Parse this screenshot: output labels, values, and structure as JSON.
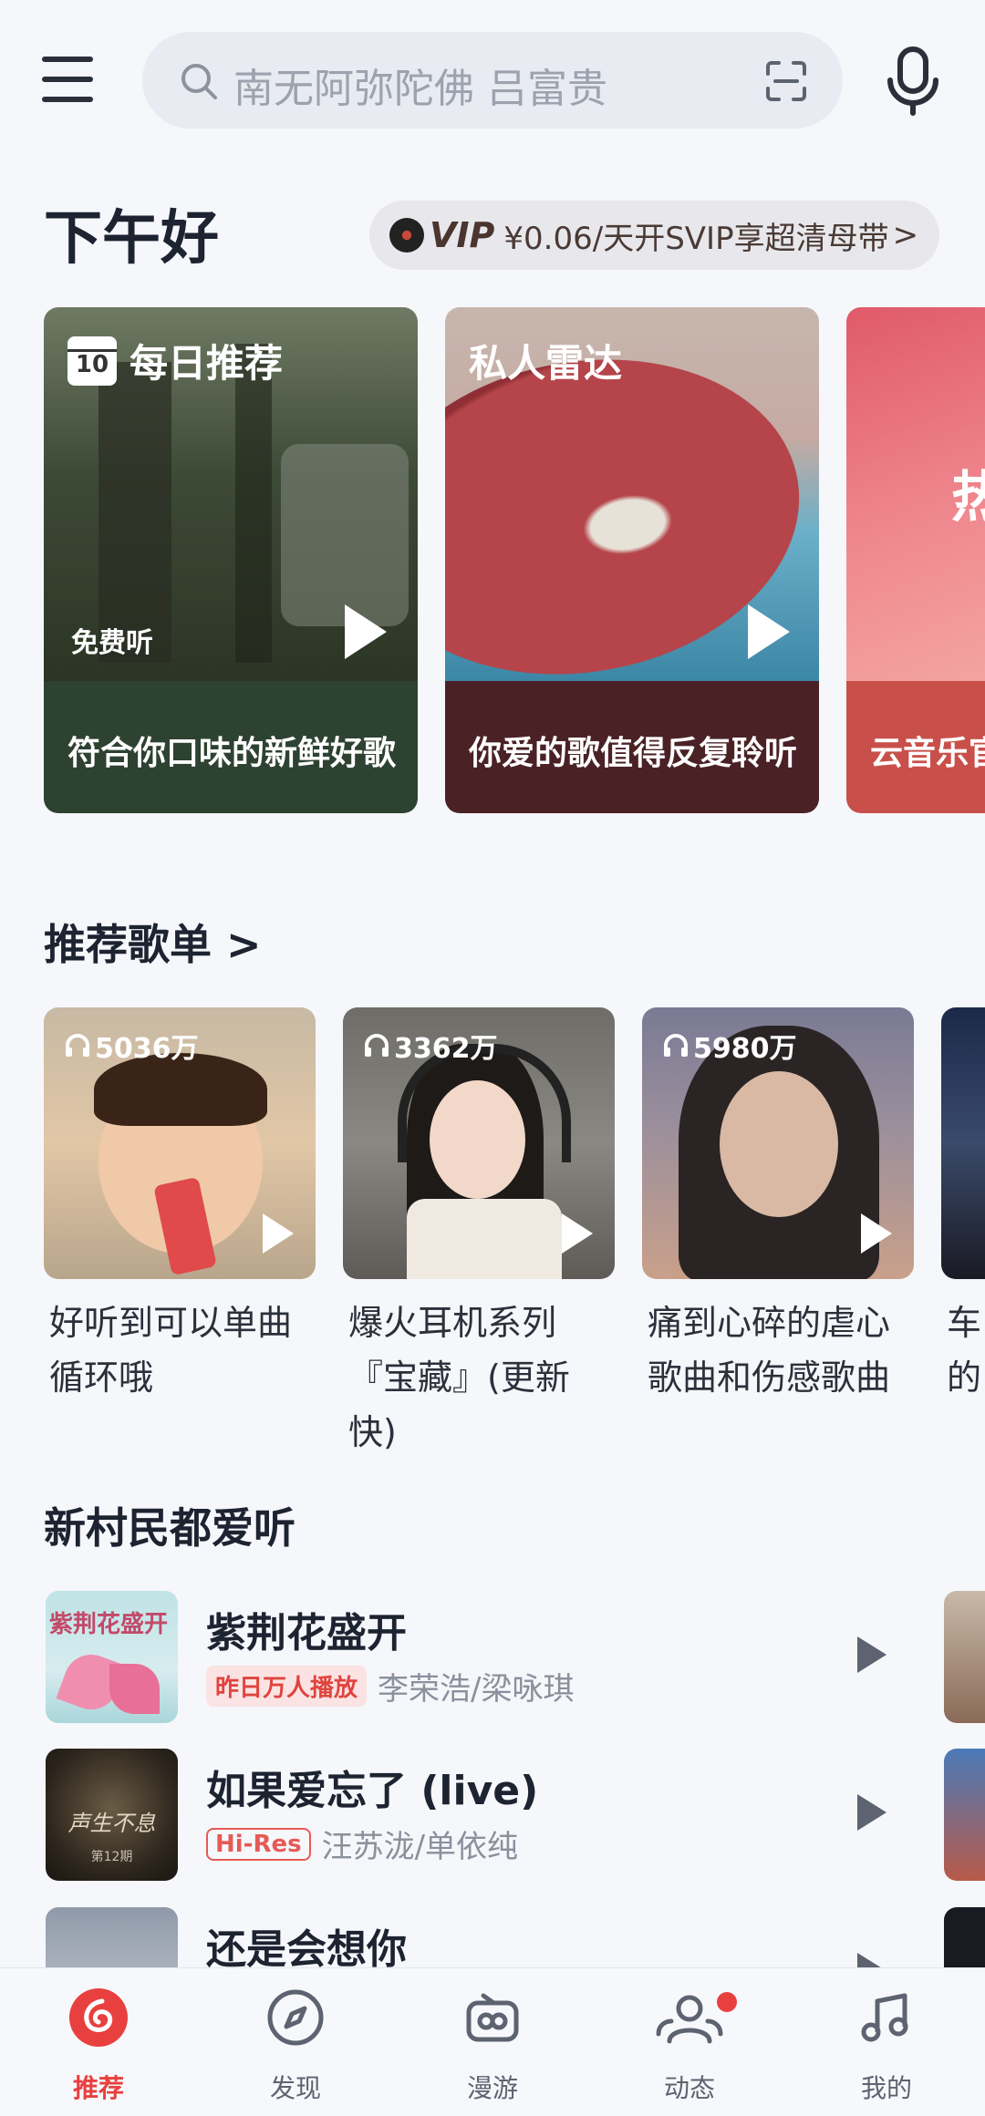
{
  "header": {
    "search_placeholder": "南无阿弥陀佛 吕富贵"
  },
  "greeting": "下午好",
  "vip_banner": {
    "badge": "VIP",
    "text": "¥0.06/天开SVIP享超清母带",
    "arrow": ">"
  },
  "cards": [
    {
      "title": "每日推荐",
      "calendar_day": "10",
      "free_label": "免费听",
      "caption": "符合你口味的新鲜好歌"
    },
    {
      "title": "私人雷达",
      "caption": "你爱的歌值得反复聆听"
    },
    {
      "title": "热",
      "caption": "云音乐官"
    }
  ],
  "playlists_section": {
    "title": "推荐歌单",
    "arrow": ">",
    "items": [
      {
        "count": "5036万",
        "name_line1": "好听到可以单曲",
        "name_line2": "循环哦"
      },
      {
        "count": "3362万",
        "name_line1": "爆火耳机系列",
        "name_line2": "『宝藏』(更新快)"
      },
      {
        "count": "5980万",
        "name_line1": "痛到心碎的虐心",
        "name_line2": "歌曲和伤感歌曲"
      },
      {
        "count": "",
        "name_line1": "车",
        "name_line2": "的"
      }
    ]
  },
  "songs_section": {
    "title": "新村民都爱听",
    "items": [
      {
        "title": "紫荆花盛开",
        "tag": "昨日万人播放",
        "tag_type": "hot",
        "artists": "李荣浩/梁咏琪",
        "cover_text": "紫荆花盛开"
      },
      {
        "title": "如果爱忘了 (live)",
        "tag": "Hi-Res",
        "tag_type": "hires",
        "artists": "汪苏泷/单依纯",
        "cover_text": "声生不息",
        "cover_sub": "第12期"
      },
      {
        "title": "还是会想你",
        "tag": "",
        "tag_type": "",
        "artists": ""
      }
    ]
  },
  "bottom_nav": [
    {
      "label": "推荐",
      "active": true
    },
    {
      "label": "发现",
      "active": false
    },
    {
      "label": "漫游",
      "active": false
    },
    {
      "label": "动态",
      "active": false,
      "badge": true
    },
    {
      "label": "我的",
      "active": false
    }
  ],
  "colors": {
    "brand_red": "#e8403f",
    "background": "#f5f7fb"
  }
}
